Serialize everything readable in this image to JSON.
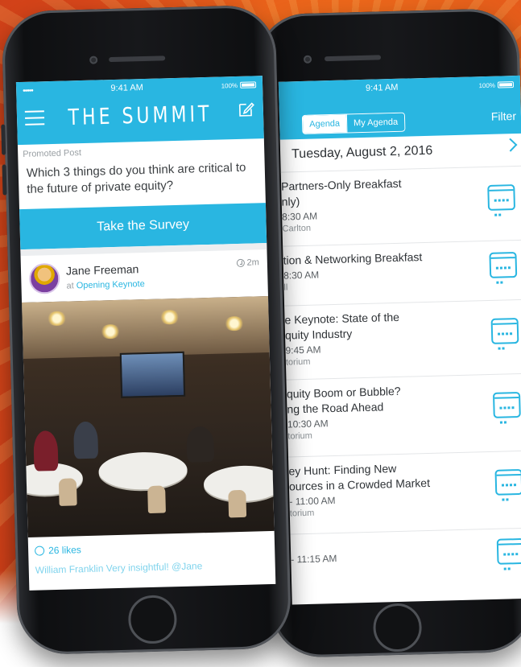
{
  "left_screen": {
    "status": {
      "time": "9:41 AM",
      "battery": "100%",
      "signal": "•••••"
    },
    "app_title": "THE SUMMIT",
    "promo": {
      "label": "Promoted Post",
      "question": "Which 3 things do you think are critical to the future of private equity?",
      "cta": "Take the Survey"
    },
    "post": {
      "author": "Jane Freeman",
      "at_prefix": "at",
      "location": "Opening Keynote",
      "time": "2m",
      "likes": "26 likes",
      "comment_preview": "William Franklin Very insightful! @Jane"
    }
  },
  "right_screen": {
    "status": {
      "time": "9:41 AM",
      "battery": "100%"
    },
    "tabs": [
      "Agenda",
      "My Agenda"
    ],
    "filter_label": "Filter",
    "date": "Tuesday, August 2, 2016",
    "sessions": [
      {
        "title": "Partners-Only Breakfast (Only)",
        "title_visible": "Partners-Only Breakfast\nnly)",
        "time": "8:30 AM",
        "location": "Carlton"
      },
      {
        "title_visible": "tion & Networking Breakfast",
        "time": "8:30 AM",
        "location": "ll"
      },
      {
        "title_visible": "e Keynote: State of the\nquity Industry",
        "time": "9:45 AM",
        "location": "torium"
      },
      {
        "title_visible": "quity Boom or Bubble?\nng the Road Ahead",
        "time": "10:30 AM",
        "location": "torium"
      },
      {
        "title_visible": "ey Hunt: Finding New\nources in a Crowded Market",
        "time": "- 11:00 AM",
        "location": "torium"
      },
      {
        "title_visible": "",
        "time": "- 11:15 AM",
        "location": ""
      }
    ]
  },
  "colors": {
    "accent": "#29b6e1",
    "background": "#ee6a1b"
  },
  "icons": [
    "hamburger-icon",
    "compose-icon",
    "clock-icon",
    "smile-icon",
    "chevron-right-icon",
    "calendar-add-icon"
  ]
}
